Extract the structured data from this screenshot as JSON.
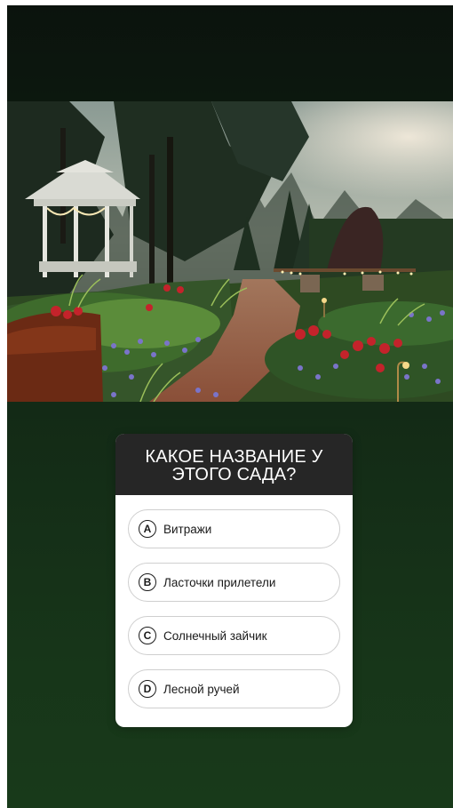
{
  "quiz": {
    "question": "КАКОЕ НАЗВАНИЕ У ЭТОГО САДА?",
    "options": [
      {
        "letter": "A",
        "text": "Витражи"
      },
      {
        "letter": "B",
        "text": "Ласточки прилетели"
      },
      {
        "letter": "C",
        "text": "Солнечный зайчик"
      },
      {
        "letter": "D",
        "text": "Лесной ручей"
      }
    ]
  },
  "colors": {
    "background_top": "#0b130d",
    "background_bottom": "#183a1a",
    "quiz_header": "#262626",
    "quiz_body": "#ffffff",
    "option_border": "#cfcfcf"
  }
}
